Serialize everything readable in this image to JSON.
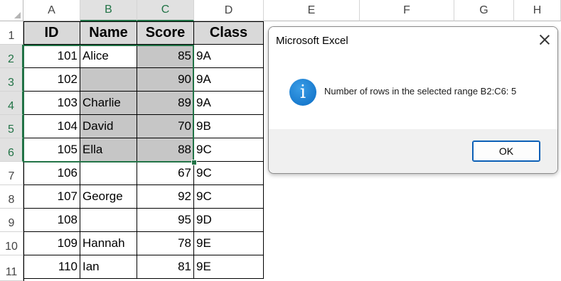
{
  "sheet": {
    "columns": [
      "A",
      "B",
      "C",
      "D",
      "E",
      "F",
      "G",
      "H"
    ],
    "rows": [
      "1",
      "2",
      "3",
      "4",
      "5",
      "6",
      "7",
      "8",
      "9",
      "10",
      "11"
    ],
    "headers": [
      "ID",
      "Name",
      "Score",
      "Class"
    ],
    "data": [
      [
        "101",
        "Alice",
        "85",
        "9A"
      ],
      [
        "102",
        "",
        "90",
        "9A"
      ],
      [
        "103",
        "Charlie",
        "89",
        "9A"
      ],
      [
        "104",
        "David",
        "70",
        "9B"
      ],
      [
        "105",
        "Ella",
        "88",
        "9C"
      ],
      [
        "106",
        "",
        "67",
        "9C"
      ],
      [
        "107",
        "George",
        "92",
        "9C"
      ],
      [
        "108",
        "",
        "95",
        "9D"
      ],
      [
        "109",
        "Hannah",
        "78",
        "9E"
      ],
      [
        "110",
        "Ian",
        "81",
        "9E"
      ]
    ],
    "selected_range": "B2:C6"
  },
  "dialog": {
    "title": "Microsoft Excel",
    "message": "Number of rows in the selected range B2:C6: 5",
    "ok_label": "OK",
    "icon": "info-icon"
  },
  "colors": {
    "selection_accent": "#217346",
    "header_fill": "#d9d9d9",
    "selected_fill": "#c6c6c6",
    "info_icon": "#0b6cc4"
  }
}
